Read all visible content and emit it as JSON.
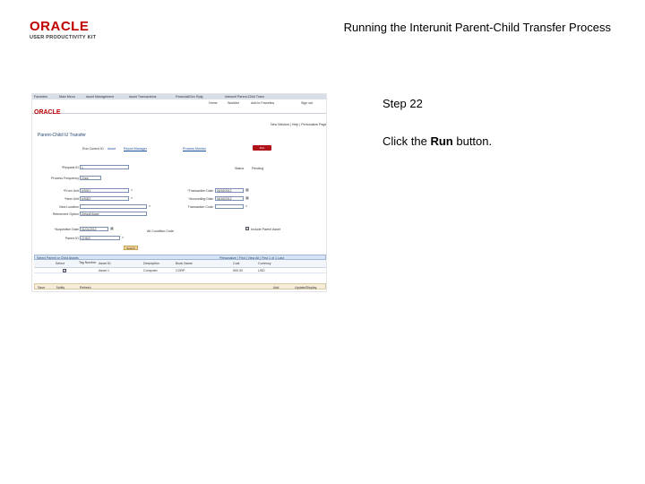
{
  "slide": {
    "logo_text": "ORACLE",
    "logo_sub": "USER PRODUCTIVITY KIT",
    "title": "Running the Interunit Parent-Child Transfer Process",
    "step": "Step 22",
    "instruction_pre": "Click the ",
    "instruction_bold": "Run",
    "instruction_post": " button."
  },
  "screenshot": {
    "menu_items": [
      "Favorites",
      "Main Menu",
      "Asset Management",
      "Asset Transactions",
      "Financial/Gov Rptg",
      "Interunit Parent-Child Trans"
    ],
    "links": [
      "Home",
      "Worklist",
      "Add to Favorites",
      "Sign out"
    ],
    "brand": "ORACLE",
    "nav_links": "New Window | Help | Personalize Page",
    "page_title": "Parent-Child IU Transfer",
    "run_control_label": "Run Control ID",
    "run_control_value": "Asset",
    "report_manager": "Report Manager",
    "process_monitor": "Process Monitor",
    "run_label": "Run",
    "request_id_label": "*Request ID",
    "request_id_value": "1",
    "status_label": "Status",
    "status_value": "Pending",
    "process_freq_label": "Process Frequency",
    "process_freq_value": "Once",
    "from_bu_label": "*From Unit",
    "from_bu_value": "US001",
    "to_bu_label": "*New Unit",
    "to_bu_value": "US002",
    "trans_date_label": "*Transaction Date",
    "trans_date_value": "06/15/2012",
    "acct_date_label": "*Accounting Date",
    "acct_date_value": "06/15/2012",
    "new_location_label": "New Location",
    "trans_code_label": "Transaction Code",
    "retire_label": "Retirement Option",
    "retire_value": "Default Asset",
    "tag_label": "*Acquisition Date",
    "tag_value": "01/01/2012",
    "condition_label": "Alt Condition Code",
    "include_parent_label": "Include Parent Asset",
    "parent_id_label": "Parent ID",
    "parent_id_value": "CHILD",
    "search_label": "Search",
    "grid_title": "Select Parent or Child Assets",
    "grid_nav": "Personalize | Find | View All | First 1 of 1 Last",
    "grid_cols": [
      "Select",
      "Tag Number",
      "Asset ID",
      "Description",
      "Book Name",
      "Cost",
      "Currency"
    ],
    "grid_row": [
      "",
      "",
      "Asset 1",
      "Computer",
      "CORP",
      "500.00",
      "USD"
    ],
    "bottom_save": "Save",
    "bottom_notify": "Notify",
    "bottom_refresh": "Refresh",
    "bottom_add": "Add",
    "bottom_update": "Update/Display"
  }
}
